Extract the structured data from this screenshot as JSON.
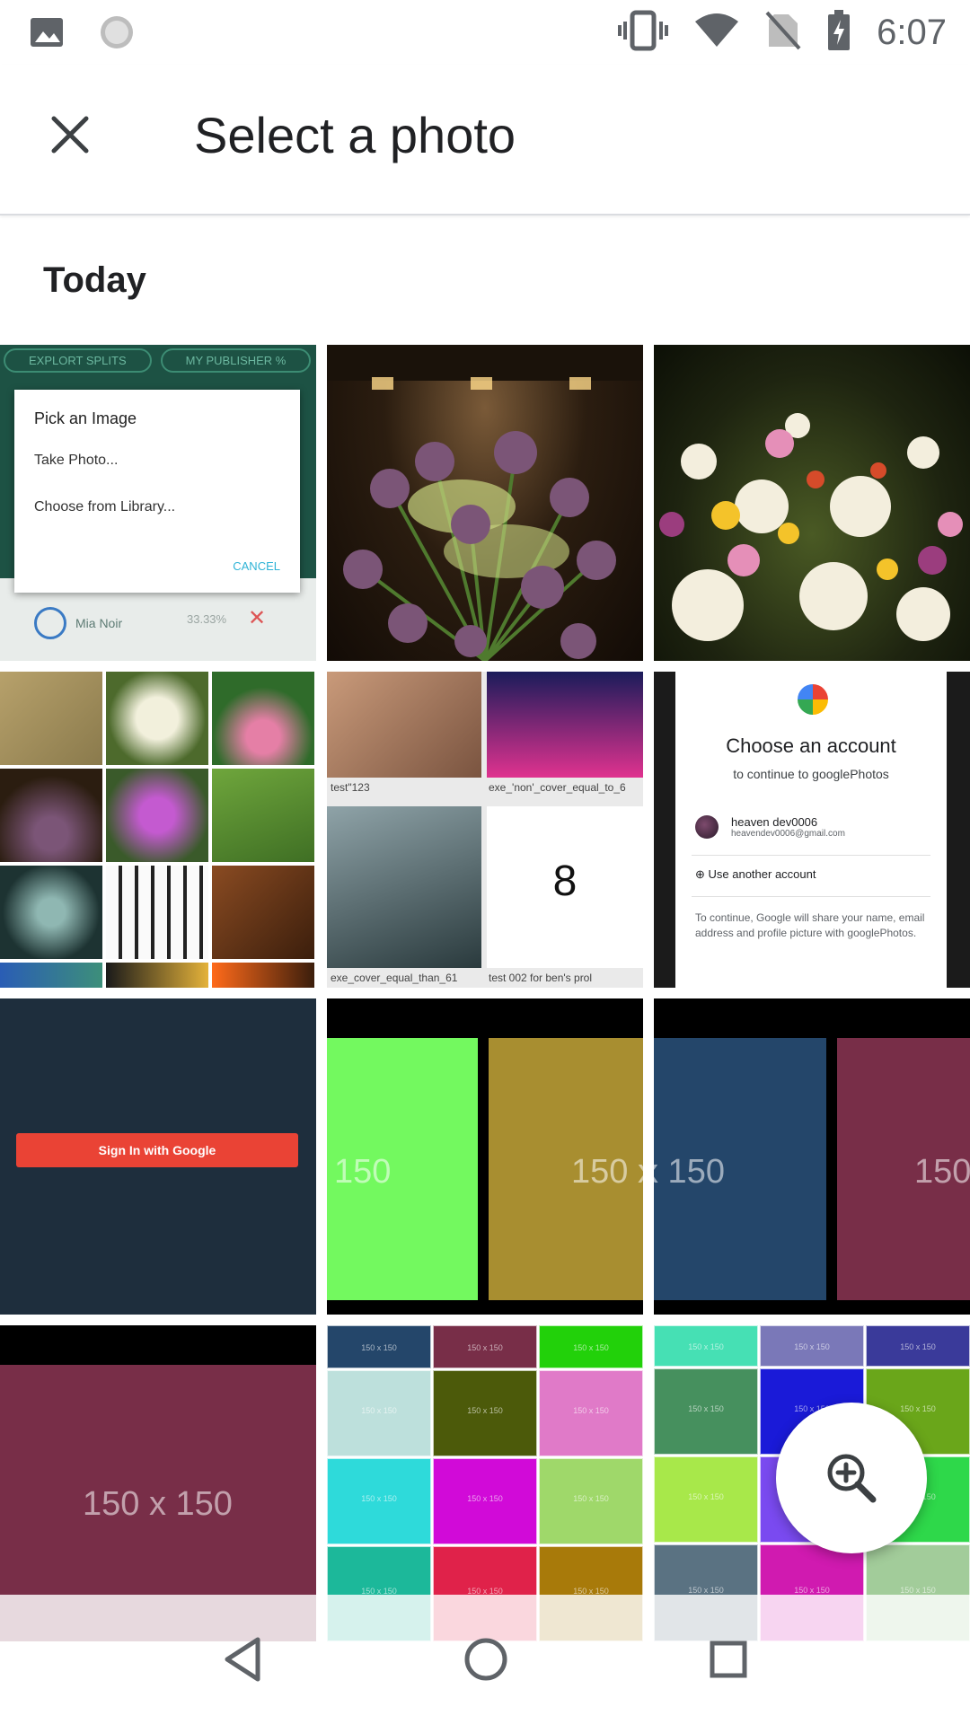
{
  "status_bar": {
    "time": "6:07",
    "left_icons": [
      "image-icon",
      "sync-icon"
    ],
    "right_icons": [
      "vibrate-icon",
      "wifi-icon",
      "no-sim-icon",
      "battery-charging-icon"
    ]
  },
  "app_bar": {
    "close_icon": "close-icon",
    "title": "Select a photo"
  },
  "section": {
    "title": "Today"
  },
  "tiles": {
    "dialog": {
      "pill_left": "EXPLORT SPLITS",
      "pill_right": "MY PUBLISHER %",
      "dialog_title": "Pick an Image",
      "option_take": "Take Photo...",
      "option_library": "Choose from Library...",
      "cancel": "CANCEL",
      "row_name": "Mia Noir",
      "row_pct": "33.33%"
    },
    "mix": {
      "label_1": "test\"123",
      "label_2": "exe_'non'_cover_equal_to_6",
      "label_3": "exe_cover_equal_than_61",
      "label_4": "test 002 for ben's prol",
      "big_digit": "8"
    },
    "account": {
      "heading": "Choose an account",
      "subheading": "to continue to googlePhotos",
      "account_name": "heaven dev0006",
      "account_email": "heavendev0006@gmail.com",
      "use_another": "Use another account",
      "note": "To continue, Google will share your name, email address and profile picture with googlePhotos."
    },
    "signin": {
      "button": "Sign In with Google"
    },
    "placeholder": {
      "label_150": "150",
      "label_150x150": "150 x 150",
      "small_label": "150 x 150"
    }
  },
  "colors": {
    "green_ph": "#73f95f",
    "olive_ph": "#a88e30",
    "navy_ph": "#24466a",
    "maroon_ph": "#782e48",
    "fab_bg": "#ffffff"
  },
  "fab": {
    "icon": "zoom-in-icon"
  },
  "nav_bar": {
    "back_icon": "back-triangle-icon",
    "home_icon": "home-circle-icon",
    "recents_icon": "recents-square-icon"
  }
}
